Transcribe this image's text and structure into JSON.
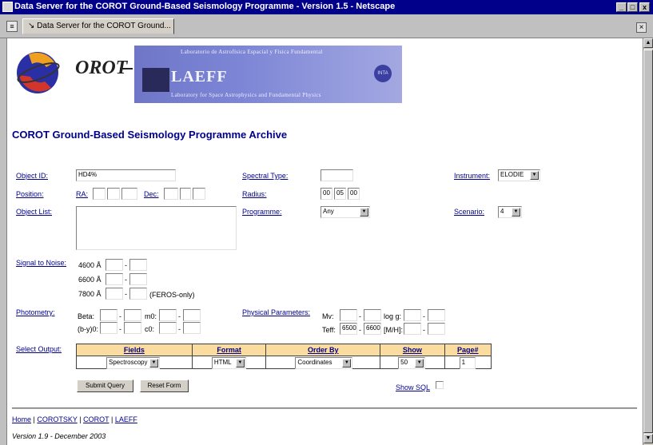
{
  "window": {
    "title": "Data Server for the COROT Ground-Based Seismology Programme - Version 1.5 - Netscape",
    "min": "_",
    "max": "□",
    "close": "x"
  },
  "tab": {
    "label": "Data Server for the COROT Ground..."
  },
  "header": {
    "logo_text": "OROT",
    "banner_top": "Laboratorio de Astrofísica Espacial y Física Fundamental",
    "banner_brand": "LAEFF",
    "banner_bottom": "Laboratory for Space Astrophysics and Fundamental Physics",
    "banner_small": "INTA"
  },
  "page_title": "COROT Ground-Based Seismology Programme Archive",
  "form": {
    "object_id_label": "Object ID:",
    "object_id_value": "HD4%",
    "position_label": "Position:",
    "ra_label": "RA:",
    "dec_label": "Dec:",
    "object_list_label": "Object List:",
    "spectral_type_label": "Spectral Type:",
    "radius_label": "Radius:",
    "radius_h": "00",
    "radius_m": "05",
    "radius_s": "00",
    "programme_label": "Programme:",
    "programme_value": "Any",
    "instrument_label": "Instrument:",
    "instrument_value": "ELODIE",
    "scenario_label": "Scenario:",
    "scenario_value": "4",
    "snr_label": "Signal to Noise:",
    "snr_rows": [
      "4600 Å",
      "6600 Å",
      "7800 Å"
    ],
    "feros_only": "(FEROS-only)",
    "photometry_label": "Photometry:",
    "beta_label": "Beta:",
    "m0_label": "m0:",
    "by0_label": "(b-y)0:",
    "c0_label": "c0:",
    "physical_label": "Physical Parameters:",
    "mv_label": "Mv:",
    "logg_label": "log g:",
    "teff_label": "Teff:",
    "teff_min": "6500",
    "teff_max": "6600",
    "mh_label": "[M/H]:",
    "dash": "-"
  },
  "output": {
    "label": "Select Output:",
    "headers": [
      "Fields",
      "Format",
      "Order By",
      "Show",
      "Page#"
    ],
    "fields_value": "Spectroscopy",
    "format_value": "HTML",
    "order_value": "Coordinates",
    "show_value": "50",
    "page_value": "1"
  },
  "buttons": {
    "submit": "Submit Query",
    "reset": "Reset Form",
    "show_sql": "Show SQL"
  },
  "footer": {
    "links": [
      "Home",
      "COROTSKY",
      "COROT",
      "LAEFF"
    ],
    "separator": "|",
    "version": "Version 1.9 - December 2003"
  }
}
